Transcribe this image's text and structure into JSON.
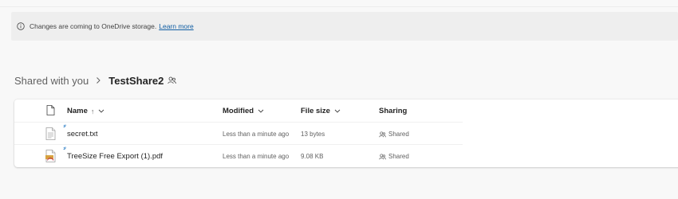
{
  "banner": {
    "message": "Changes are coming to OneDrive storage.",
    "link": "Learn more"
  },
  "breadcrumb": {
    "root": "Shared with you",
    "current": "TestShare2"
  },
  "table": {
    "columns": {
      "name": "Name",
      "sort_indicator": "↑",
      "modified": "Modified",
      "file_size": "File size",
      "sharing": "Sharing"
    },
    "rows": [
      {
        "name": "secret.txt",
        "modified": "Less than a minute ago",
        "size": "13 bytes",
        "sharing": "Shared",
        "icon": "text-file-icon"
      },
      {
        "name": "TreeSize Free Export (1).pdf",
        "modified": "Less than a minute ago",
        "size": "9.08 KB",
        "sharing": "Shared",
        "icon": "pdf-file-icon"
      }
    ]
  },
  "colors": {
    "link": "#115ea3",
    "pdf_accent": "#d7a23f"
  }
}
